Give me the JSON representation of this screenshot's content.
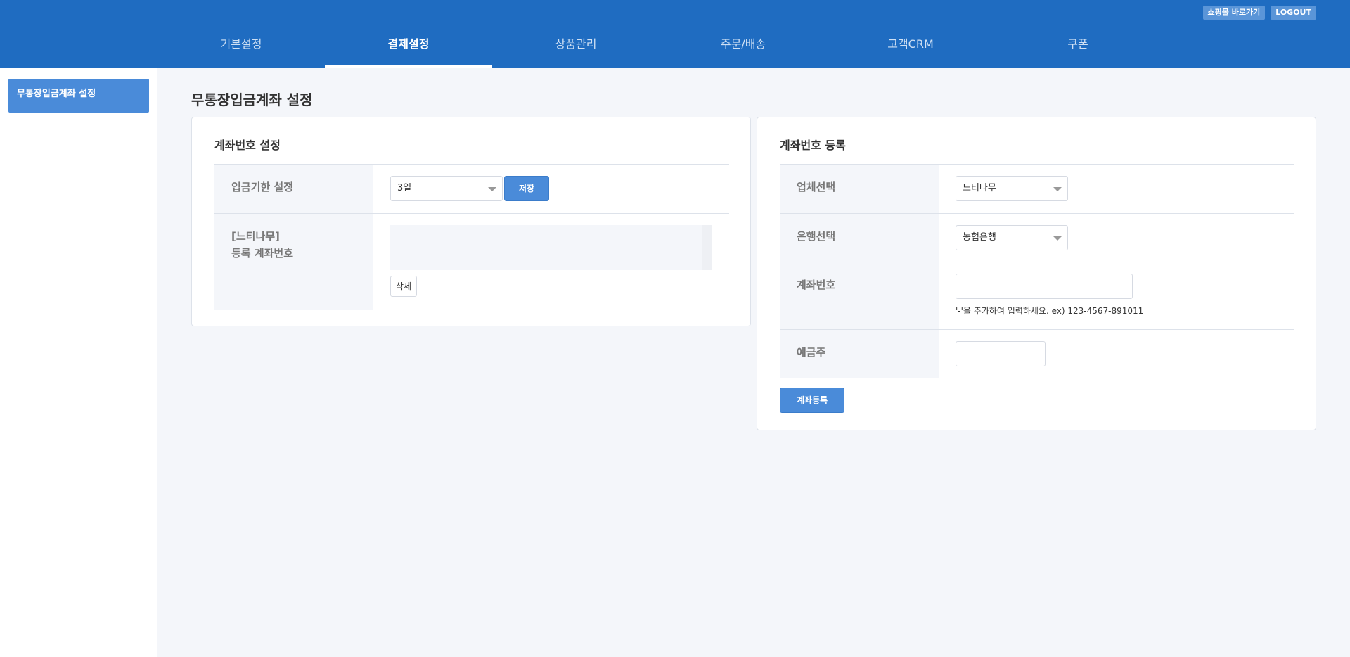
{
  "header": {
    "top_links": [
      "쇼핑몰 바로가기",
      "LOGOUT"
    ],
    "nav": [
      {
        "label": "기본설정",
        "active": false
      },
      {
        "label": "결제설정",
        "active": true
      },
      {
        "label": "상품관리",
        "active": false
      },
      {
        "label": "주문/배송",
        "active": false
      },
      {
        "label": "고객CRM",
        "active": false
      },
      {
        "label": "쿠폰",
        "active": false
      }
    ]
  },
  "sidebar": {
    "items": [
      {
        "label": "무통장입금계좌 설정",
        "active": true
      }
    ]
  },
  "page": {
    "title": "무통장입금계좌 설정"
  },
  "left_card": {
    "title": "계좌번호 설정",
    "deadline_label": "입금기한 설정",
    "deadline_value": "3일",
    "save_label": "저장",
    "registered_label_line1": "[느티나무]",
    "registered_label_line2": "등록 계좌번호",
    "delete_label": "삭제"
  },
  "right_card": {
    "title": "계좌번호 등록",
    "company_label": "업체선택",
    "company_value": "느티나무",
    "bank_label": "은행선택",
    "bank_value": "농협은행",
    "account_label": "계좌번호",
    "account_value": "",
    "account_help": "'-'을 추가하여 입력하세요. ex) 123-4567-891011",
    "holder_label": "예금주",
    "holder_value": "",
    "register_label": "계좌등록"
  },
  "colors": {
    "header": "#1f6cc1",
    "accent": "#4a8bd9",
    "background": "#f4f6fa"
  }
}
